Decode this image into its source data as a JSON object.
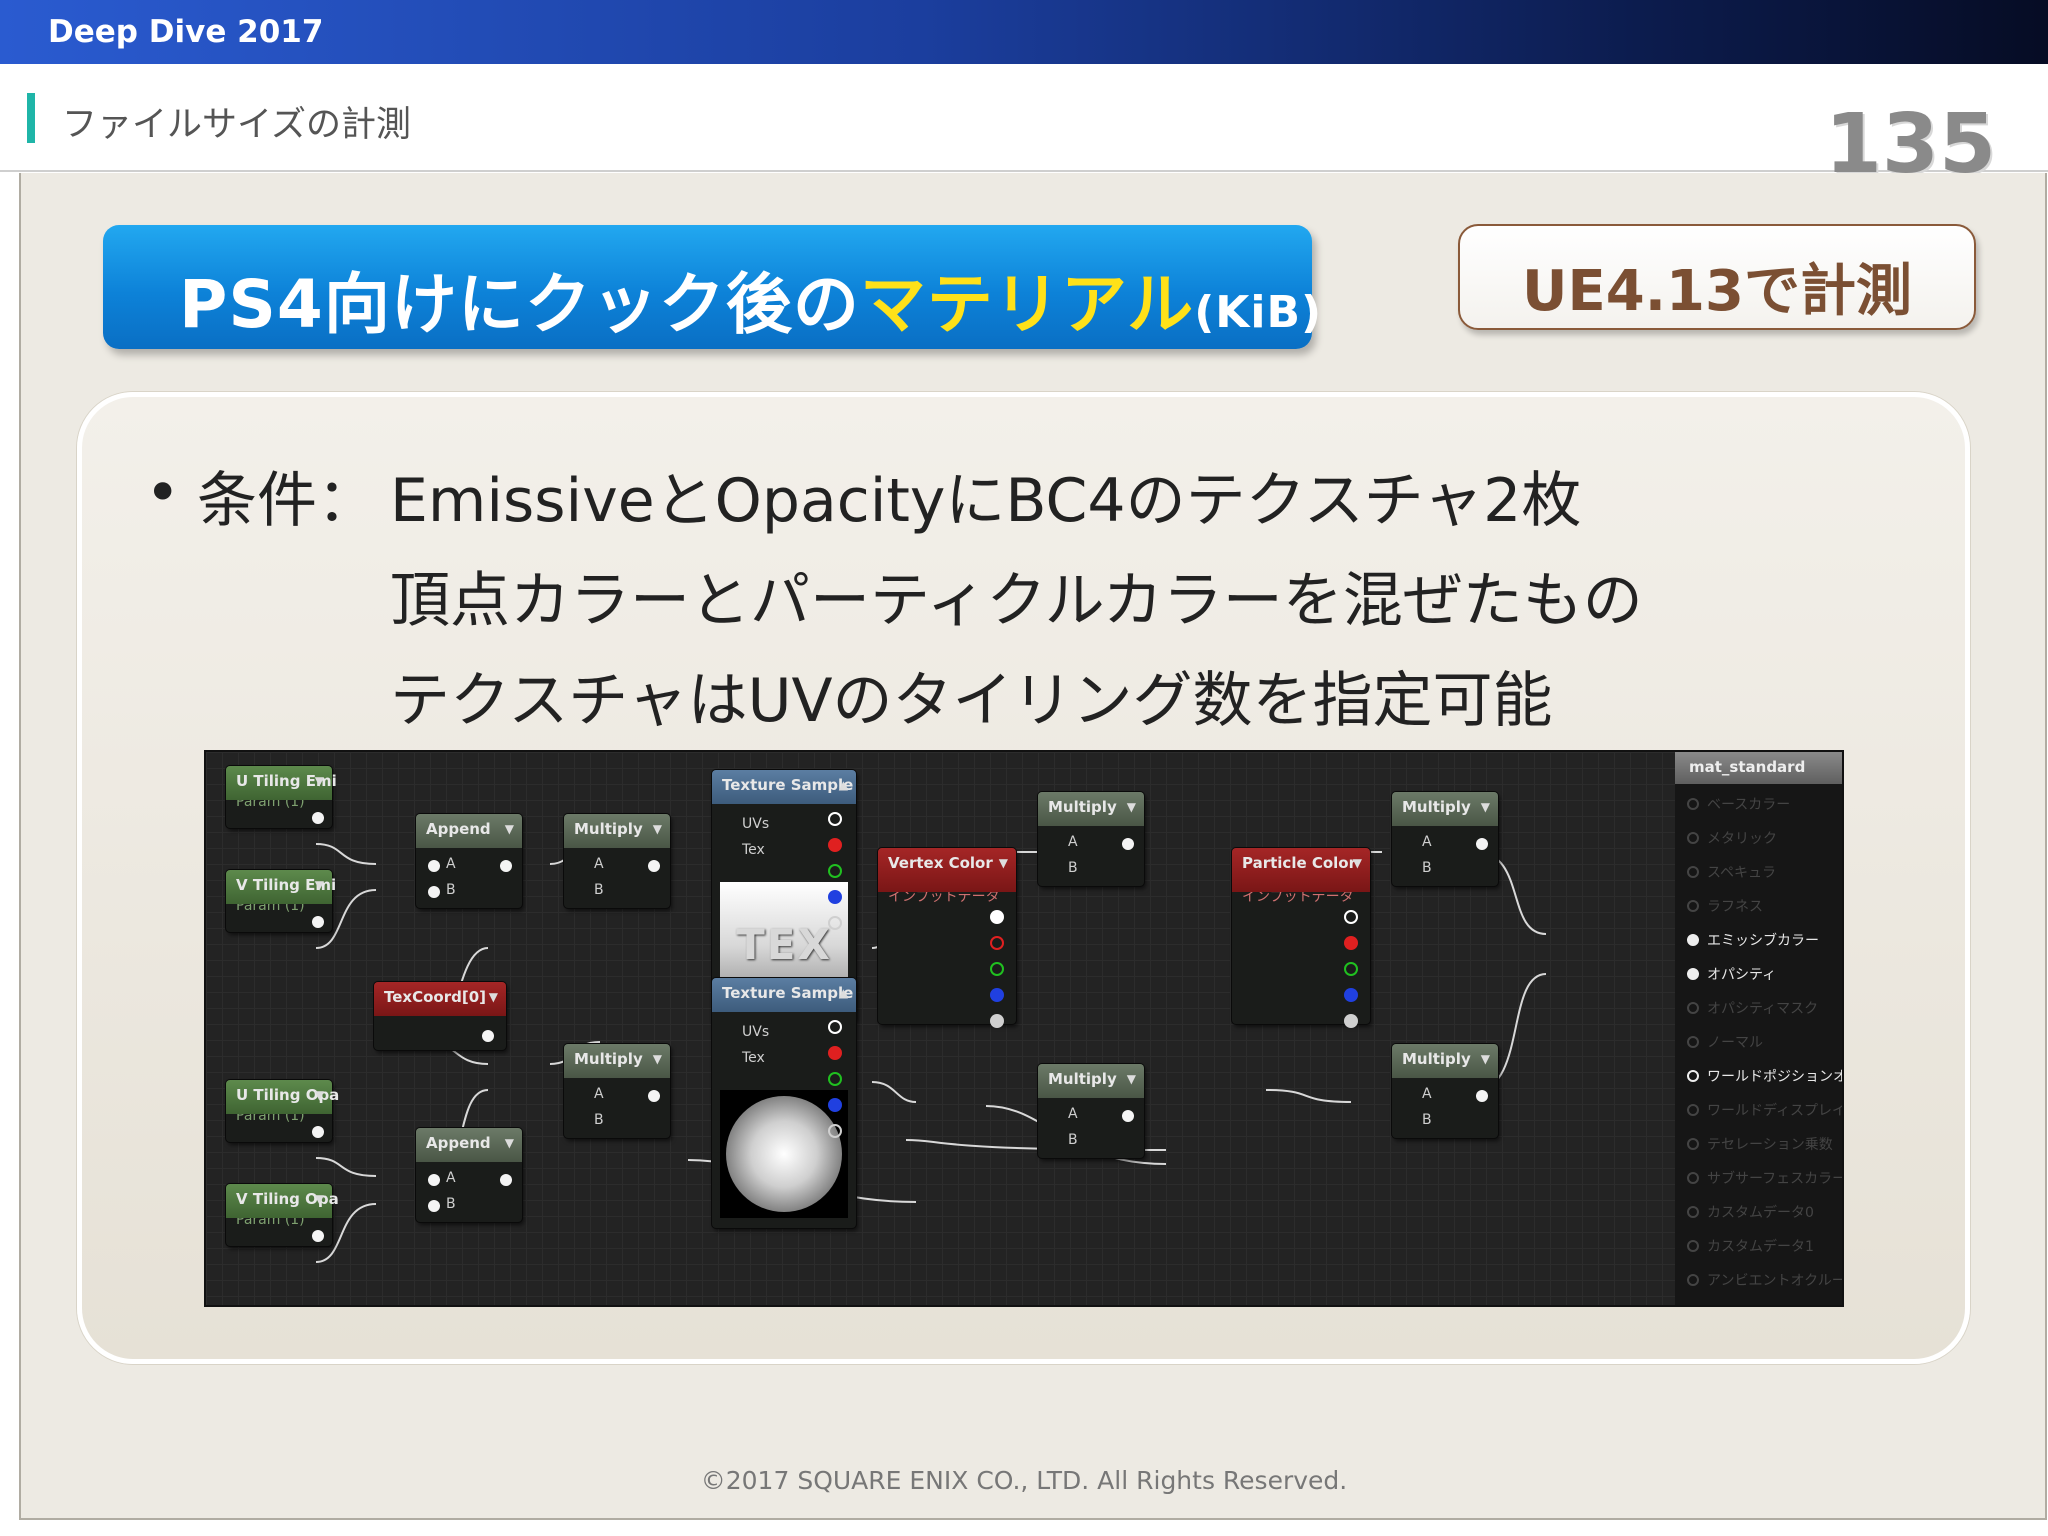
{
  "brand": "Deep Dive 2017",
  "header": {
    "title": "ファイルサイズの計測",
    "page_number": "135"
  },
  "main_title": {
    "prefix": "PS4向けにクック後の",
    "highlight": "マテリアル",
    "unit": "(KiB)"
  },
  "version_badge": "UE4.13で計測",
  "conditions": {
    "bullet": "•",
    "prefix": "条件：",
    "lines": [
      "EmissiveとOpacityにBC4のテクスチャ2枚",
      "頂点カラーとパーティクルカラーを混ぜたもの",
      "テクスチャはUVのタイリング数を指定可能"
    ]
  },
  "graph": {
    "nodes": {
      "u_tiling_emi": {
        "title": "U Tiling Emi",
        "sub": "Param (1)"
      },
      "v_tiling_emi": {
        "title": "V Tiling Emi",
        "sub": "Param (1)"
      },
      "u_tiling_opa": {
        "title": "U Tiling Opa",
        "sub": "Param (1)"
      },
      "v_tiling_opa": {
        "title": "V Tiling Opa",
        "sub": "Param (1)"
      },
      "append1": {
        "title": "Append"
      },
      "append2": {
        "title": "Append"
      },
      "texcoord": {
        "title": "TexCoord[0]"
      },
      "multiply1": {
        "title": "Multiply"
      },
      "multiply2": {
        "title": "Multiply"
      },
      "multiply3": {
        "title": "Multiply"
      },
      "multiply4": {
        "title": "Multiply"
      },
      "multiply5": {
        "title": "Multiply"
      },
      "multiply6": {
        "title": "Multiply"
      },
      "texture_sample1": {
        "title": "Texture Sample",
        "preview": "TEX"
      },
      "texture_sample2": {
        "title": "Texture Sample"
      },
      "vertex_color": {
        "title": "Vertex Color",
        "sub": "インプットデータ"
      },
      "particle_color": {
        "title": "Particle Color",
        "sub": "インプットデータ"
      }
    },
    "pins": {
      "a": "A",
      "b": "B",
      "uvs": "UVs",
      "tex": "Tex"
    },
    "material": {
      "title": "mat_standard",
      "inputs": [
        {
          "label": "ベースカラー",
          "state": "off"
        },
        {
          "label": "メタリック",
          "state": "off"
        },
        {
          "label": "スペキュラ",
          "state": "off"
        },
        {
          "label": "ラフネス",
          "state": "off"
        },
        {
          "label": "エミッシブカラー",
          "state": "on"
        },
        {
          "label": "オパシティ",
          "state": "on"
        },
        {
          "label": "オパシティマスク",
          "state": "off"
        },
        {
          "label": "ノーマル",
          "state": "off"
        },
        {
          "label": "ワールドポジションオフセット",
          "state": "ring"
        },
        {
          "label": "ワールドディスプレイスメント",
          "state": "off"
        },
        {
          "label": "テセレーション乗数",
          "state": "off"
        },
        {
          "label": "サブサーフェスカラー",
          "state": "off"
        },
        {
          "label": "カスタムデータ0",
          "state": "off"
        },
        {
          "label": "カスタムデータ1",
          "state": "off"
        },
        {
          "label": "アンビエントオクルージョン",
          "state": "off"
        }
      ]
    }
  },
  "copyright": "©2017 SQUARE ENIX CO., LTD. All Rights Reserved.",
  "colors": {
    "accent_teal": "#1fb5a8",
    "title_blue": "#0d82d8",
    "title_highlight": "#ffe119",
    "badge_brown": "#7b4f33"
  }
}
